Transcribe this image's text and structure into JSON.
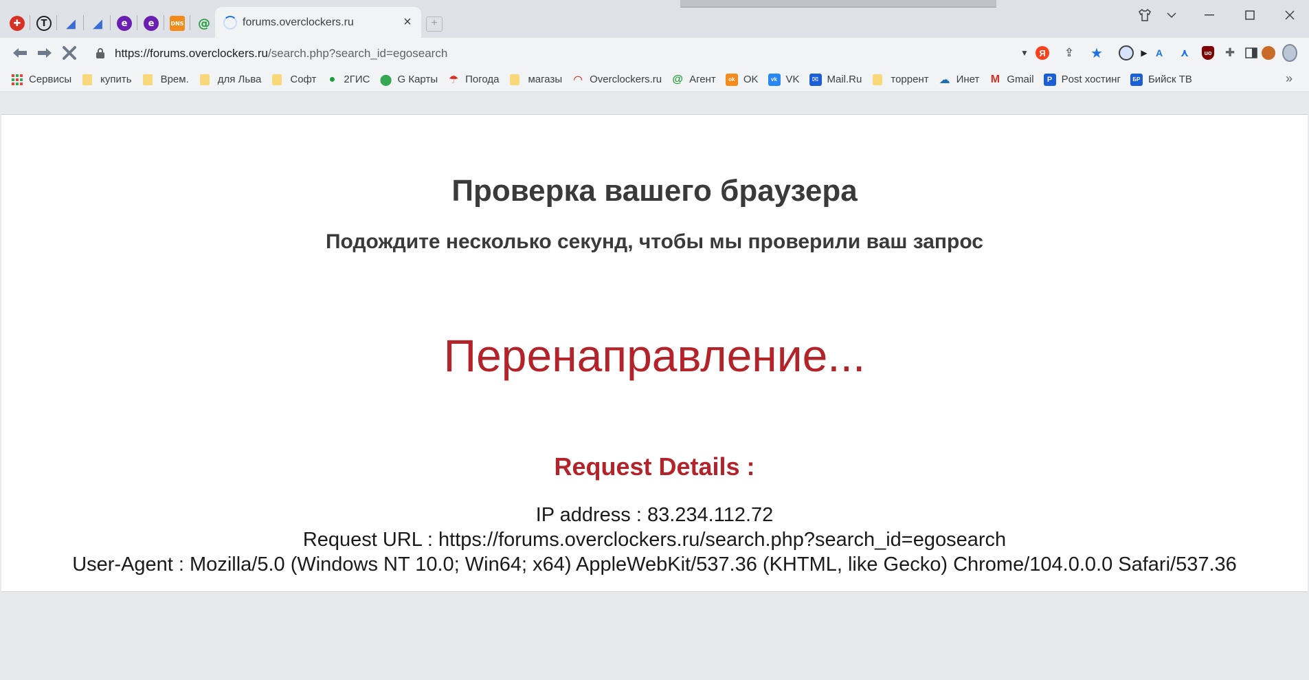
{
  "tabs": {
    "active": {
      "title": "forums.overclockers.ru"
    },
    "pinned": [
      {
        "name": "pinned-tab-red",
        "glyph": "✚",
        "color": "#d93025"
      },
      {
        "name": "pinned-tab-t",
        "glyph": "T",
        "color": "#202124"
      },
      {
        "name": "pinned-tab-blue-a",
        "glyph": "◢",
        "color": "#3b6ed3"
      },
      {
        "name": "pinned-tab-blue-b",
        "glyph": "◢",
        "color": "#3b6ed3"
      },
      {
        "name": "pinned-tab-purple-a",
        "glyph": "e",
        "color": "#6b1fb1"
      },
      {
        "name": "pinned-tab-purple-b",
        "glyph": "e",
        "color": "#6b1fb1"
      },
      {
        "name": "pinned-tab-dns",
        "glyph": "DNS",
        "color": "#f28b1a"
      },
      {
        "name": "pinned-tab-green",
        "glyph": "@",
        "color": "#1e9e3a"
      }
    ]
  },
  "toolbar": {
    "url_host": "https://forums.overclockers.ru",
    "url_path": "/search.php?search_id=egosearch"
  },
  "bookmarks": [
    {
      "label": "Сервисы",
      "icon": "apps-grid-icon",
      "type": "apps"
    },
    {
      "label": "купить",
      "type": "folder"
    },
    {
      "label": "Врем.",
      "type": "folder"
    },
    {
      "label": "для Льва",
      "type": "folder"
    },
    {
      "label": "Софт",
      "type": "folder"
    },
    {
      "label": "2ГИС",
      "type": "icon",
      "color": "#1e9e3a",
      "glyph": "●"
    },
    {
      "label": "G Карты",
      "type": "icon",
      "color": "#34a853",
      "glyph": "⬤"
    },
    {
      "label": "Погода",
      "type": "icon",
      "color": "#d93025",
      "glyph": "☂"
    },
    {
      "label": "магазы",
      "type": "folder"
    },
    {
      "label": "Overclockers.ru",
      "type": "icon",
      "color": "#c5221f",
      "glyph": "◠"
    },
    {
      "label": "Агент",
      "type": "icon",
      "color": "#1e9e3a",
      "glyph": "@"
    },
    {
      "label": "OK",
      "type": "icon",
      "color": "#f28b1a",
      "glyph": "ok"
    },
    {
      "label": "VK",
      "type": "icon",
      "color": "#2787f5",
      "glyph": "vk"
    },
    {
      "label": "Mail.Ru",
      "type": "icon",
      "color": "#1a5ed8",
      "glyph": "✉"
    },
    {
      "label": "торрент",
      "type": "folder"
    },
    {
      "label": "Инет",
      "type": "icon",
      "color": "#1f6fb5",
      "glyph": "☁"
    },
    {
      "label": "Gmail",
      "type": "icon",
      "color": "#d93025",
      "glyph": "M"
    },
    {
      "label": "Post хостинг",
      "type": "icon",
      "color": "#1a5ed8",
      "glyph": "P"
    },
    {
      "label": "Бийск ТВ",
      "type": "icon",
      "color": "#1a5ed8",
      "glyph": "БР"
    }
  ],
  "page": {
    "heading": "Проверка вашего браузера",
    "subheading": "Подождите несколько секунд, чтобы мы проверили ваш запрос",
    "redirect": "Перенаправление...",
    "details_heading": "Request Details :",
    "ip_line": "IP address : 83.234.112.72",
    "url_line": "Request URL : https://forums.overclockers.ru/search.php?search_id=egosearch",
    "ua_line": "User-Agent : Mozilla/5.0 (Windows NT 10.0; Win64; x64) AppleWebKit/537.36 (KHTML, like Gecko) Chrome/104.0.0.0 Safari/537.36"
  }
}
